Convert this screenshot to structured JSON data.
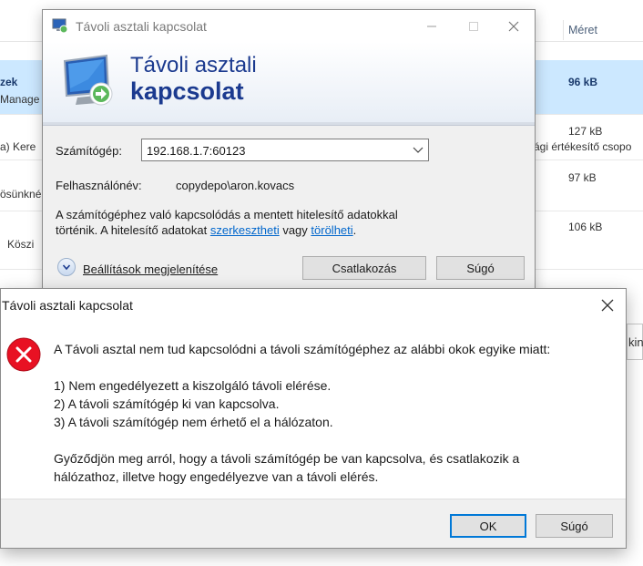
{
  "background": {
    "column_header": "Méret",
    "rows": [
      {
        "left": "zek",
        "left2": "Manage",
        "size": "96 kB",
        "selected": true
      },
      {
        "left": "a)  Kere",
        "right_text": "ági értékesítő csopo",
        "size": "127 kB"
      },
      {
        "left": "ösünknél",
        "size": "97 kB"
      },
      {
        "left": "Köszi",
        "size": "106 kB"
      },
      {
        "right_text": "kin"
      }
    ]
  },
  "rdp": {
    "title": "Távoli asztali kapcsolat",
    "banner_line1": "Távoli asztali",
    "banner_line2": "kapcsolat",
    "computer_label": "Számítógép:",
    "computer_value": "192.168.1.7:60123",
    "username_label": "Felhasználónév:",
    "username_value": "copydepo\\aron.kovacs",
    "info_line1": "A számítógéphez való kapcsolódás a mentett hitelesítő adatokkal",
    "info_line2_prefix": "történik. A hitelesítő adatokat ",
    "info_link_edit": "szerkesztheti",
    "info_mid": " vagy ",
    "info_link_delete": "törölheti",
    "info_end": ".",
    "show_options": "Beállítások megjelenítése",
    "connect_button": "Csatlakozás",
    "help_button": "Súgó"
  },
  "error": {
    "title": "Távoli asztali kapcsolat",
    "message_main": "A Távoli asztal nem tud kapcsolódni a távoli számítógéphez az alábbi okok egyike miatt:",
    "reasons": [
      "1) Nem engedélyezett a kiszolgáló távoli elérése.",
      "2) A távoli számítógép ki van kapcsolva.",
      "3) A távoli számítógép nem érhető el a hálózaton."
    ],
    "advice_line1": "Győződjön meg arról, hogy a távoli számítógép be van kapcsolva, és csatlakozik a",
    "advice_line2": "hálózathoz, illetve hogy engedélyezve van a távoli elérés.",
    "ok_button": "OK",
    "help_button": "Súgó"
  },
  "colors": {
    "accent": "#0078d7",
    "banner_text": "#1b3a8f",
    "error_icon": "#e81123",
    "selection": "#cce8ff"
  },
  "icons": [
    "rdp-icon",
    "minimize-icon",
    "maximize-icon",
    "close-icon",
    "chevron-down-icon",
    "expand-options-icon",
    "error-icon"
  ]
}
